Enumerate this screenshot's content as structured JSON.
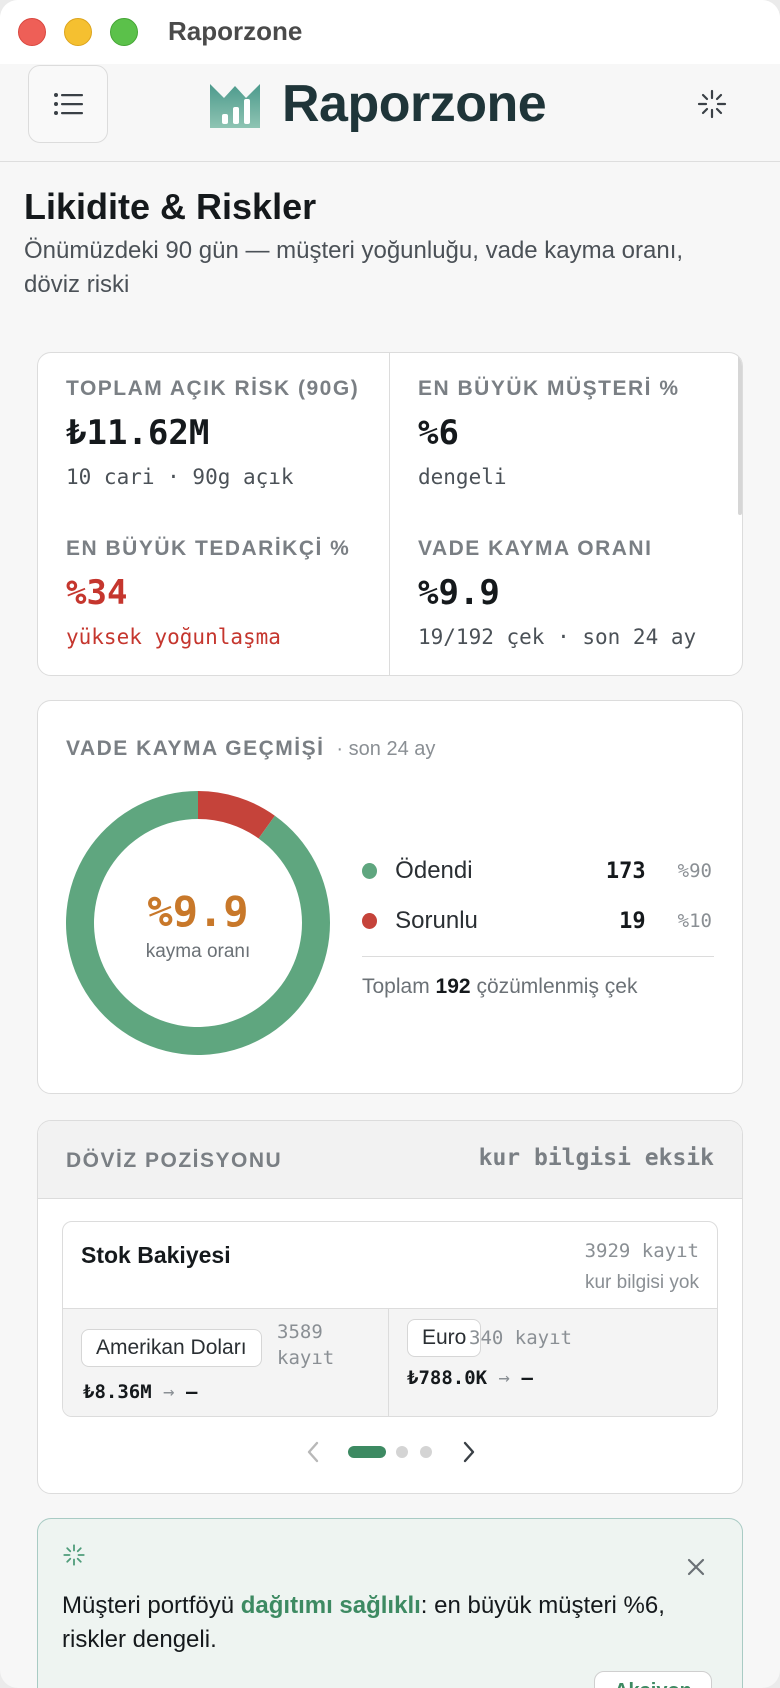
{
  "window": {
    "title": "Raporzone"
  },
  "header": {
    "brand": "Raporzone"
  },
  "page": {
    "title": "Likidite & Riskler",
    "subtitle": "Önümüzdeki 90 gün — müşteri yoğunluğu, vade kayma oranı, döviz riski"
  },
  "kpis": {
    "open_risk": {
      "label": "TOPLAM AÇIK RİSK (90G)",
      "value": "₺11.62M",
      "note": "10 cari · 90g açık"
    },
    "top_customer": {
      "label": "EN BÜYÜK MÜŞTERİ %",
      "value": "%6",
      "note": "dengeli"
    },
    "top_supplier": {
      "label": "EN BÜYÜK TEDARİKÇİ %",
      "value": "%34",
      "note": "yüksek yoğunlaşma"
    },
    "slip_rate": {
      "label": "VADE KAYMA ORANI",
      "value": "%9.9",
      "note": "19/192 çek · son 24 ay"
    }
  },
  "vade": {
    "label": "VADE KAYMA GEÇMİŞİ",
    "sublabel": "· son 24 ay",
    "center_value": "%9.9",
    "center_label": "kayma oranı",
    "legend": [
      {
        "name": "Ödendi",
        "count": "173",
        "pct": "%90",
        "color": "#5fa67f"
      },
      {
        "name": "Sorunlu",
        "count": "19",
        "pct": "%10",
        "color": "#c5433a"
      }
    ],
    "total_prefix": "Toplam",
    "total_value": "192",
    "total_suffix": "çözümlenmiş çek"
  },
  "chart_data": {
    "type": "pie",
    "categories": [
      "Ödendi",
      "Sorunlu"
    ],
    "values": [
      173,
      19
    ],
    "title": "VADE KAYMA GEÇMİŞİ",
    "colors": [
      "#5fa67f",
      "#c5433a"
    ]
  },
  "fx": {
    "label": "DÖVİZ POZİSYONU",
    "warning": "kur bilgisi eksik",
    "stock_title": "Stok Bakiyesi",
    "stock_count": "3929 kayıt",
    "stock_note": "kur bilgisi yok",
    "currencies": [
      {
        "name": "Amerikan Doları",
        "count": "3589 kayıt",
        "value": "₺8.36M",
        "arrow": "→",
        "fx_value": "—"
      },
      {
        "name": "Euro",
        "count": "340 kayıt",
        "value": "₺788.0K",
        "arrow": "→",
        "fx_value": "—"
      }
    ],
    "pager": {
      "pages": 3,
      "active": 0
    }
  },
  "insight": {
    "text_prefix": "Müşteri portföyü ",
    "text_highlight": "dağıtımı sağlıklı",
    "text_suffix": ": en büyük müşteri %6, riskler dengeli.",
    "button": "Aksiyon"
  },
  "icons": {
    "menu": "menu-icon",
    "brand": "bar-chart-logo-icon",
    "spark": "sparkle-icon",
    "close": "close-icon",
    "prev": "chevron-left-icon",
    "next": "chevron-right-icon"
  }
}
